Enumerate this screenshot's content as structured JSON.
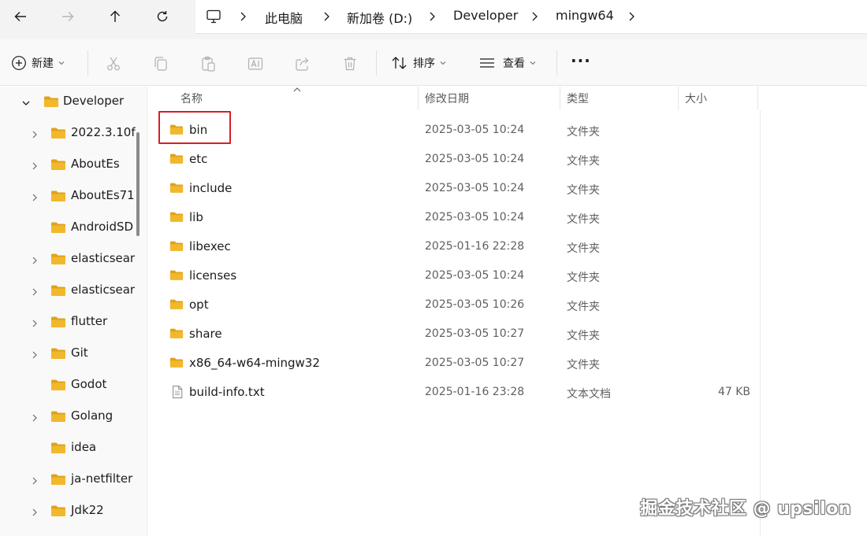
{
  "breadcrumb": [
    "此电脑",
    "新加卷 (D:)",
    "Developer",
    "mingw64"
  ],
  "toolbar": {
    "new_label": "新建",
    "sort_label": "排序",
    "view_label": "查看",
    "more_label": "···"
  },
  "columns": {
    "name": "名称",
    "modified": "修改日期",
    "type": "类型",
    "size": "大小"
  },
  "sidebar": {
    "items": [
      {
        "label": "Developer",
        "expanded": true
      },
      {
        "label": "2022.3.10f",
        "expandable": true
      },
      {
        "label": "AboutEs",
        "expandable": true
      },
      {
        "label": "AboutEs71",
        "expandable": true
      },
      {
        "label": "AndroidSD",
        "expandable": false
      },
      {
        "label": "elasticsear",
        "expandable": true
      },
      {
        "label": "elasticsear",
        "expandable": true
      },
      {
        "label": "flutter",
        "expandable": true
      },
      {
        "label": "Git",
        "expandable": true
      },
      {
        "label": "Godot",
        "expandable": false
      },
      {
        "label": "Golang",
        "expandable": true
      },
      {
        "label": "idea",
        "expandable": false
      },
      {
        "label": "ja-netfilter",
        "expandable": true
      },
      {
        "label": "Jdk22",
        "expandable": true
      }
    ]
  },
  "files": [
    {
      "name": "bin",
      "modified": "2025-03-05 10:24",
      "type": "文件夹",
      "size": "",
      "icon": "folder-icon",
      "highlighted": true
    },
    {
      "name": "etc",
      "modified": "2025-03-05 10:24",
      "type": "文件夹",
      "size": "",
      "icon": "folder-icon"
    },
    {
      "name": "include",
      "modified": "2025-03-05 10:24",
      "type": "文件夹",
      "size": "",
      "icon": "folder-icon"
    },
    {
      "name": "lib",
      "modified": "2025-03-05 10:24",
      "type": "文件夹",
      "size": "",
      "icon": "folder-icon"
    },
    {
      "name": "libexec",
      "modified": "2025-01-16 22:28",
      "type": "文件夹",
      "size": "",
      "icon": "folder-icon"
    },
    {
      "name": "licenses",
      "modified": "2025-03-05 10:24",
      "type": "文件夹",
      "size": "",
      "icon": "folder-icon"
    },
    {
      "name": "opt",
      "modified": "2025-03-05 10:26",
      "type": "文件夹",
      "size": "",
      "icon": "folder-icon"
    },
    {
      "name": "share",
      "modified": "2025-03-05 10:27",
      "type": "文件夹",
      "size": "",
      "icon": "folder-icon"
    },
    {
      "name": "x86_64-w64-mingw32",
      "modified": "2025-03-05 10:27",
      "type": "文件夹",
      "size": "",
      "icon": "folder-icon"
    },
    {
      "name": "build-info.txt",
      "modified": "2025-01-16 23:28",
      "type": "文本文档",
      "size": "47 KB",
      "icon": "text-file-icon"
    }
  ],
  "watermark": "掘金技术社区 @ upsilon",
  "colors": {
    "folder": "#f2b82c",
    "folder_dark": "#e0a21a",
    "highlight": "#d4202a"
  }
}
